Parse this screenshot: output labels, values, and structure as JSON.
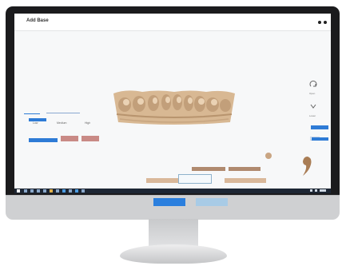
{
  "app": {
    "title": "Add Base",
    "menu_icon": "more-dots-icon"
  },
  "colors": {
    "accent": "#2e7bd6",
    "rose": "#c98a86",
    "tan": "#b08a6f",
    "sand": "#d9b89a",
    "taskbar": "#1d2634",
    "model": "#d8b893"
  },
  "left_panel": {
    "labels": [
      "Low",
      "Medium",
      "High"
    ]
  },
  "right_panel": {
    "labels": [
      "Open",
      "Lower"
    ],
    "icons": [
      "rotate-icon",
      "chevron-down-icon"
    ]
  }
}
